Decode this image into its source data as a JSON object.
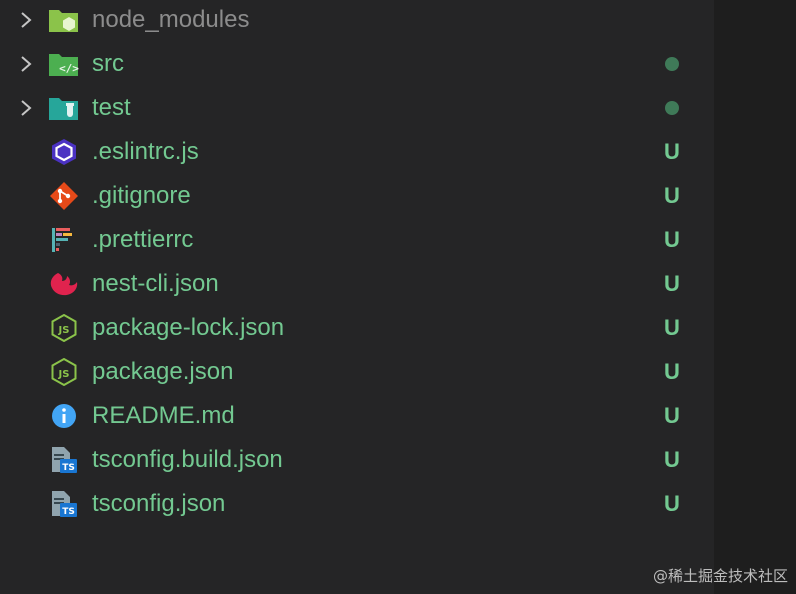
{
  "colors": {
    "untracked_text": "#73c991",
    "ignored_text": "#8c8c8c",
    "dot": "#3f7a58",
    "panel_bg": "#252526"
  },
  "rows": [
    {
      "name": "node_modules",
      "kind": "folder",
      "icon": "folder-node-icon",
      "status": "",
      "ignored": true
    },
    {
      "name": "src",
      "kind": "folder",
      "icon": "folder-src-icon",
      "status": "dot"
    },
    {
      "name": "test",
      "kind": "folder",
      "icon": "folder-test-icon",
      "status": "dot"
    },
    {
      "name": ".eslintrc.js",
      "kind": "file",
      "icon": "eslint-icon",
      "status": "U"
    },
    {
      "name": ".gitignore",
      "kind": "file",
      "icon": "git-icon",
      "status": "U"
    },
    {
      "name": ".prettierrc",
      "kind": "file",
      "icon": "prettier-icon",
      "status": "U"
    },
    {
      "name": "nest-cli.json",
      "kind": "file",
      "icon": "nestjs-icon",
      "status": "U"
    },
    {
      "name": "package-lock.json",
      "kind": "file",
      "icon": "nodejs-icon",
      "status": "U"
    },
    {
      "name": "package.json",
      "kind": "file",
      "icon": "nodejs-icon",
      "status": "U"
    },
    {
      "name": "README.md",
      "kind": "file",
      "icon": "info-icon",
      "status": "U"
    },
    {
      "name": "tsconfig.build.json",
      "kind": "file",
      "icon": "tsconfig-icon",
      "status": "U"
    },
    {
      "name": "tsconfig.json",
      "kind": "file",
      "icon": "tsconfig-icon",
      "status": "U"
    }
  ],
  "watermark": "@稀土掘金技术社区"
}
